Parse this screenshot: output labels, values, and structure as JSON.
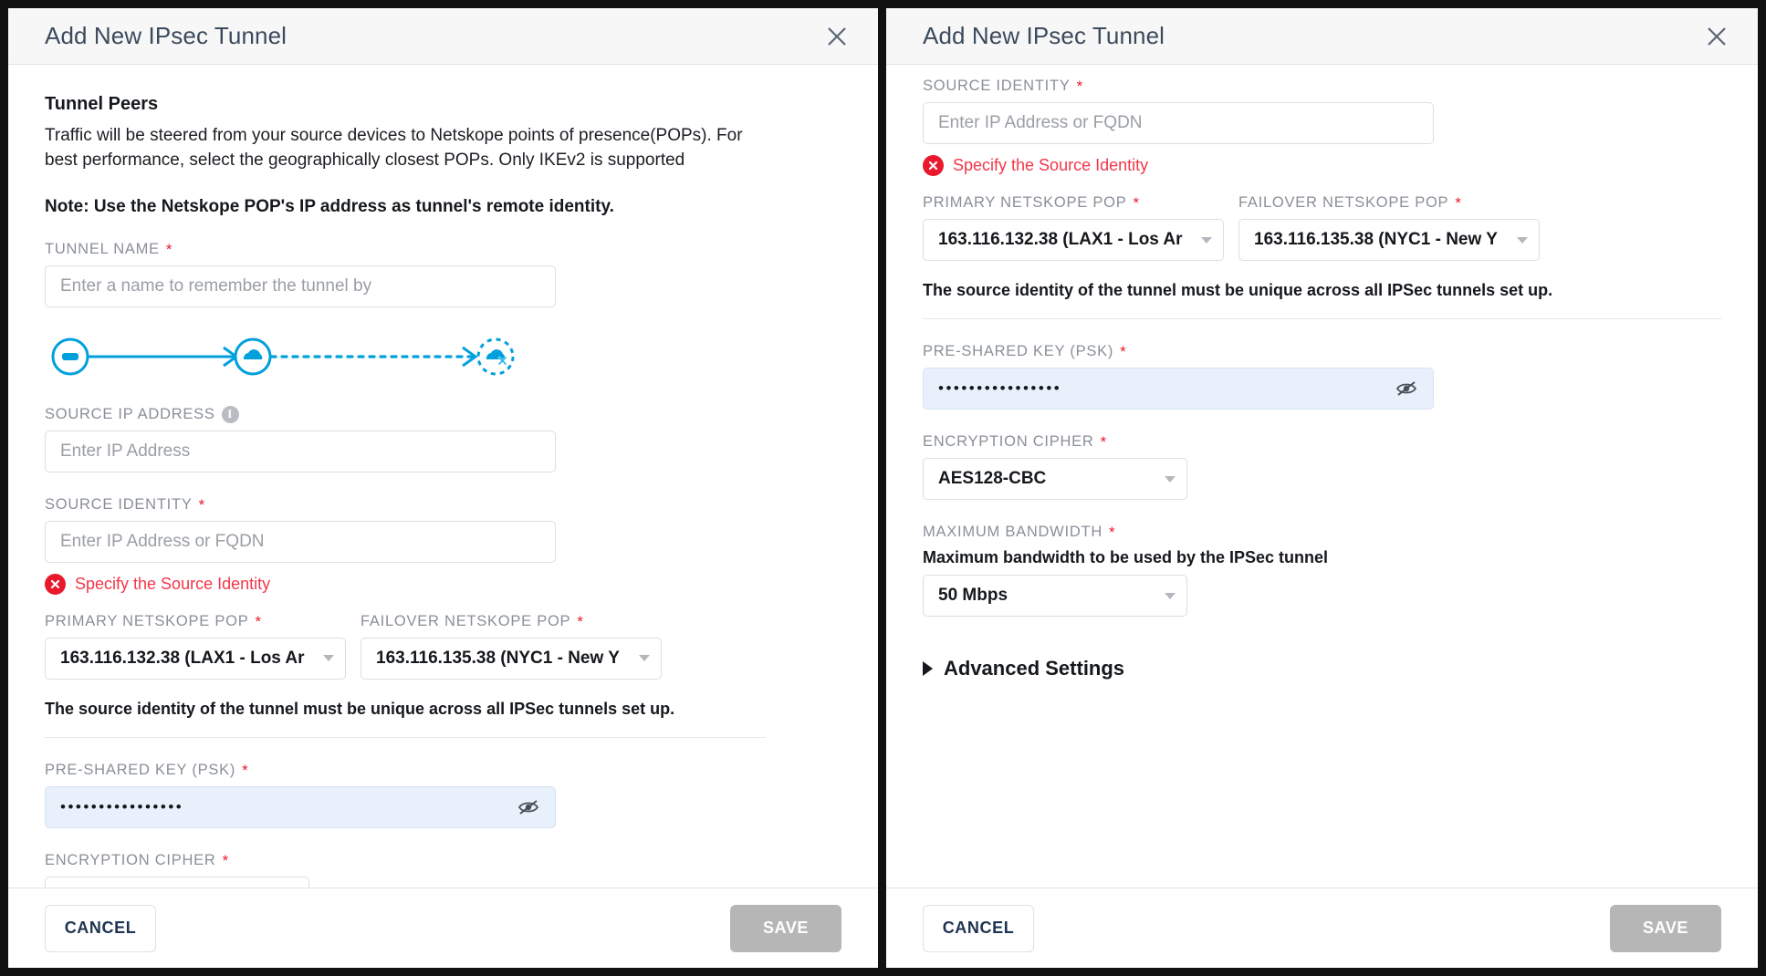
{
  "accent": "#00a0dd",
  "error_color": "#f2374a",
  "dialog": {
    "title": "Add New IPsec Tunnel",
    "close_icon": "close-icon"
  },
  "intro": {
    "section_title": "Tunnel Peers",
    "description": "Traffic will be steered from your source devices to Netskope points of presence(POPs). For best performance, select the geographically closest POPs. Only IKEv2 is supported",
    "note": "Note: Use the Netskope POP's IP address as tunnel's remote identity."
  },
  "fields": {
    "tunnel_name": {
      "label": "TUNNEL NAME",
      "required": true,
      "placeholder": "Enter a name to remember the tunnel by",
      "value": ""
    },
    "source_ip": {
      "label": "SOURCE IP ADDRESS",
      "required": false,
      "info_icon": "info-icon",
      "placeholder": "Enter IP Address",
      "value": ""
    },
    "source_identity": {
      "label": "SOURCE IDENTITY",
      "required": true,
      "placeholder": "Enter IP Address or FQDN",
      "value": "",
      "error": "Specify the Source Identity",
      "error_icon": "error-circle-x-icon"
    },
    "primary_pop": {
      "label": "PRIMARY NETSKOPE POP",
      "required": true,
      "value": "163.116.132.38 (LAX1 - Los Ar"
    },
    "failover_pop": {
      "label": "FAILOVER NETSKOPE POP",
      "required": true,
      "value": "163.116.135.38 (NYC1 - New Y"
    },
    "unique_note": "The source identity of the tunnel must be unique across all IPSec tunnels set up.",
    "psk": {
      "label": "PRE-SHARED KEY (PSK)",
      "required": true,
      "value": "••••••••••••••••",
      "toggle_icon": "eye-off-icon"
    },
    "encryption_cipher": {
      "label": "ENCRYPTION CIPHER",
      "required": true,
      "value": "AES128-CBC"
    },
    "max_bandwidth": {
      "label": "MAXIMUM BANDWIDTH",
      "required": true,
      "description": "Maximum bandwidth to be used by the IPSec tunnel",
      "value": "50 Mbps"
    }
  },
  "advanced": {
    "label": "Advanced Settings",
    "caret_icon": "caret-right-icon",
    "expanded": false
  },
  "diagram": {
    "node1_icon": "device-icon",
    "node2_icon": "cloud-icon",
    "node3_icon": "cloud-disconnected-icon",
    "link1_style": "solid",
    "link2_style": "dotted"
  },
  "footer": {
    "cancel_label": "CANCEL",
    "save_label": "SAVE",
    "save_disabled": true
  }
}
